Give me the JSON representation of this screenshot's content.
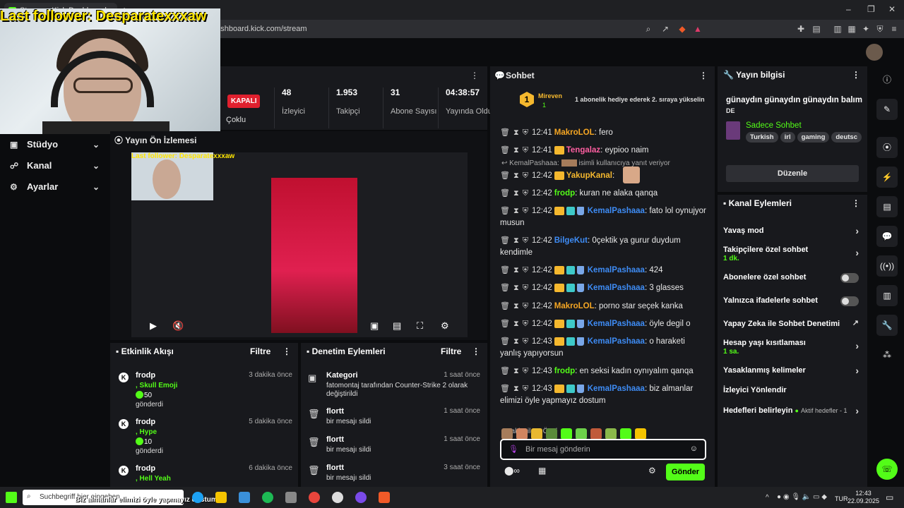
{
  "browser": {
    "tab_title": "Stream - Kick Dashboard",
    "url": "dashboard.kick.com/stream",
    "new_tab": "+"
  },
  "overlay": {
    "last_follower": "Last follower: Desparatexxxaw"
  },
  "nav": {
    "items": [
      {
        "icon": "▣",
        "label": "Stüdyo"
      },
      {
        "icon": "☍",
        "label": "Kanal"
      },
      {
        "icon": "⚙",
        "label": "Ayarlar"
      }
    ]
  },
  "stats": {
    "status": "KAPALI",
    "mode": "Çoklu",
    "viewers": {
      "value": "48",
      "label": "İzleyici"
    },
    "followers": {
      "value": "1.953",
      "label": "Takipçi"
    },
    "subs": {
      "value": "31",
      "label": "Abone Sayısı"
    },
    "uptime": {
      "value": "04:38:57",
      "label": "Yayında Olduğu"
    }
  },
  "preview": {
    "title": "Yayın Ön İzlemesi",
    "overlay_text": "Last follower: Desparatexxxaw"
  },
  "activity": {
    "title": "Etkinlik Akışı",
    "filter": "Filtre",
    "items": [
      {
        "name": "frodp",
        "time": "3 dakika önce",
        "item": ", Skull Emoji",
        "amount": "50",
        "verb": "gönderdi"
      },
      {
        "name": "frodp",
        "time": "5 dakika önce",
        "item": ", Hype",
        "amount": "10",
        "verb": "gönderdi"
      },
      {
        "name": "frodp",
        "time": "6 dakika önce",
        "item": ", Hell Yeah",
        "amount": "",
        "verb": ""
      }
    ]
  },
  "moderation": {
    "title": "Denetim Eylemleri",
    "filter": "Filtre",
    "items": [
      {
        "name": "Kategori",
        "time": "1 saat önce",
        "desc": "fatomontaj tarafından Counter-Strike 2 olarak değiştirildi"
      },
      {
        "name": "flortt",
        "time": "1 saat önce",
        "desc": "bir mesajı sildi"
      },
      {
        "name": "flortt",
        "time": "1 saat önce",
        "desc": "bir mesajı sildi"
      },
      {
        "name": "flortt",
        "time": "3 saat önce",
        "desc": "bir mesajı sildi"
      }
    ]
  },
  "chat": {
    "title": "Sohbet",
    "pinned_user": "Mireven",
    "pinned_count": "1",
    "pinned_rank": "1",
    "pinned_note": "1 abonelik hediye ederek 2. sıraya yükselin",
    "reply_note": "KemalPashaaa:",
    "reply_note2": "isimli kullanıcıya yanıt veriyor",
    "messages": [
      {
        "time": "12:41",
        "user": "MakroLOL",
        "color": "#f5a623",
        "badges": "",
        "text": ": fero"
      },
      {
        "time": "12:41",
        "user": "Tengalaz",
        "color": "#ff5fa2",
        "badges": "c",
        "text": ": eypioo naim"
      },
      {
        "time": "12:42",
        "user": "YakupKanal",
        "color": "#f5b82e",
        "badges": "c",
        "text": ":"
      },
      {
        "time": "12:42",
        "user": "frodp",
        "color": "#53fc18",
        "badges": "",
        "text": ": kuran ne alaka qanqa"
      },
      {
        "time": "12:42",
        "user": "KemalPashaaa",
        "color": "#3e8cf5",
        "badges": "cgs",
        "text": ": fato lol oynujyor musun"
      },
      {
        "time": "12:42",
        "user": "BilgeKut",
        "color": "#3e8cf5",
        "badges": "",
        "text": ": 0çektik ya gurur duydum kendimle"
      },
      {
        "time": "12:42",
        "user": "KemalPashaaa",
        "color": "#3e8cf5",
        "badges": "cgs",
        "text": ": 424"
      },
      {
        "time": "12:42",
        "user": "KemalPashaaa",
        "color": "#3e8cf5",
        "badges": "cgs",
        "text": ": 3 glasses"
      },
      {
        "time": "12:42",
        "user": "MakroLOL",
        "color": "#f5a623",
        "badges": "",
        "text": ": porno star seçek kanka"
      },
      {
        "time": "12:42",
        "user": "KemalPashaaa",
        "color": "#3e8cf5",
        "badges": "cgs",
        "text": ": öyle degil o"
      },
      {
        "time": "12:43",
        "user": "KemalPashaaa",
        "color": "#3e8cf5",
        "badges": "cgs",
        "text": ": o haraketi yanlış yapıyorsun"
      },
      {
        "time": "12:43",
        "user": "frodp",
        "color": "#53fc18",
        "badges": "",
        "text": ": en seksi kadın oynıyalım qanqa"
      },
      {
        "time": "12:43",
        "user": "KemalPashaaa",
        "color": "#3e8cf5",
        "badges": "cgs",
        "text": ": biz almanlar elimizi öyle yapmayız dostum"
      }
    ],
    "followers_only": "Takipçilere Özel",
    "input_placeholder": "Bir mesaj gönderin",
    "send": "Gönder"
  },
  "stream_info": {
    "title": "Yayın bilgisi",
    "stream_title": "günaydın günaydın günaydın balım",
    "lang": "DE",
    "category": "Sadece Sohbet",
    "tags": [
      "Turkish",
      "irl",
      "gaming",
      "deutsc"
    ],
    "edit": "Düzenle"
  },
  "channel_actions": {
    "title": "Kanal Eylemleri",
    "rows": [
      {
        "label": "Yavaş mod",
        "sub": "",
        "kind": "chev"
      },
      {
        "label": "Takipçilere özel sohbet",
        "sub": "1 dk.",
        "kind": "chev"
      },
      {
        "label": "Abonelere özel sohbet",
        "sub": "",
        "kind": "toggle"
      },
      {
        "label": "Yalnızca ifadelerle sohbet",
        "sub": "",
        "kind": "toggle"
      },
      {
        "label": "Yapay Zeka ile Sohbet Denetimi",
        "sub": "",
        "kind": "ext"
      },
      {
        "label": "Hesap yaşı kısıtlaması",
        "sub": "1 sa.",
        "kind": "chev"
      },
      {
        "label": "Yasaklanmış kelimeler",
        "sub": "",
        "kind": "chev"
      },
      {
        "label": "İzleyici Yönlendir",
        "sub": "",
        "kind": "none"
      },
      {
        "label": "Hedefleri belirleyin",
        "sub": "",
        "kind": "chev"
      }
    ],
    "goals_note": "Aktif hedefler - 1"
  },
  "taskbar": {
    "search": "Suchbegriff hier eingeben",
    "ticker": "Biz almanlar elimizi öyle yapmayız dostum",
    "lang": "TUR",
    "time": "12:43",
    "date": "22.09.2025"
  },
  "colors": {
    "kick_green": "#53fc18",
    "live_red": "#e0202e"
  }
}
